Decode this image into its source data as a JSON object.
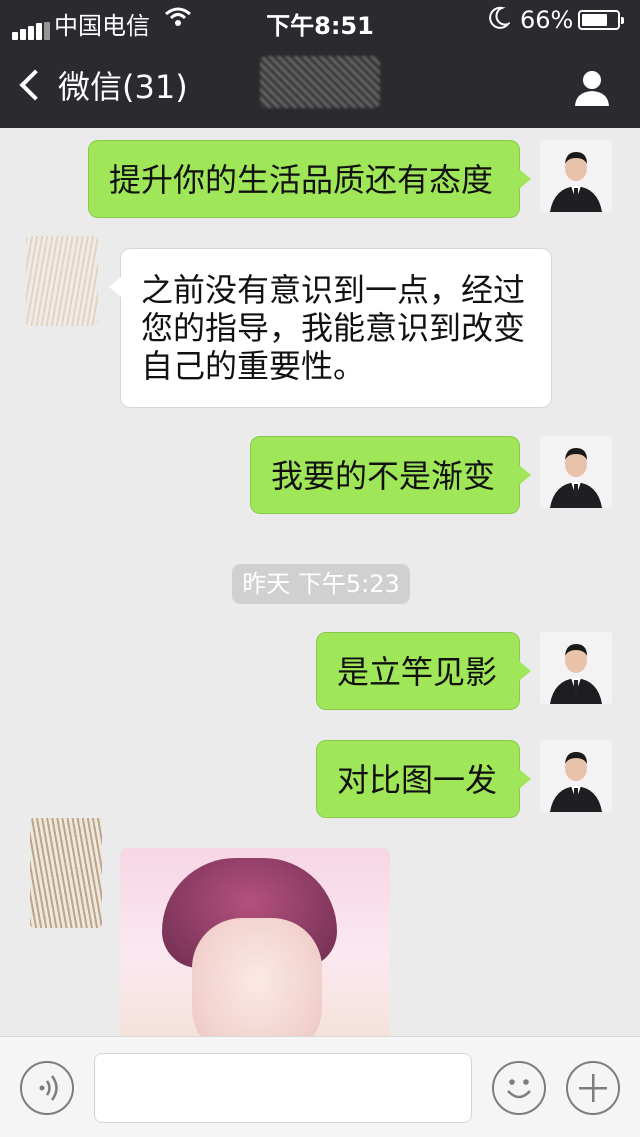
{
  "status_bar": {
    "carrier": "中国电信",
    "time": "下午8:51",
    "battery": "66%",
    "battery_level": 0.66
  },
  "nav": {
    "back_label": "微信(31)"
  },
  "messages": [
    {
      "from": "me",
      "text": "提升你的生活品质还有态度"
    },
    {
      "from": "other",
      "text": "之前没有意识到一点，经过您的指导，我能意识到改变自己的重要性。"
    },
    {
      "from": "me",
      "text": "我要的不是渐变"
    },
    {
      "from": "me",
      "text": "是立竿见影"
    },
    {
      "from": "me",
      "text": "对比图一发"
    }
  ],
  "timestamp": "昨天 下午5:23",
  "input_bar": {
    "voice_icon": "voice-icon",
    "emoji_icon": "emoji-icon",
    "plus_icon": "plus-icon"
  },
  "colors": {
    "nav_bg": "#2b2b2f",
    "chat_bg": "#ebebeb",
    "me_bubble": "#9fe658",
    "other_bubble": "#ffffff"
  }
}
